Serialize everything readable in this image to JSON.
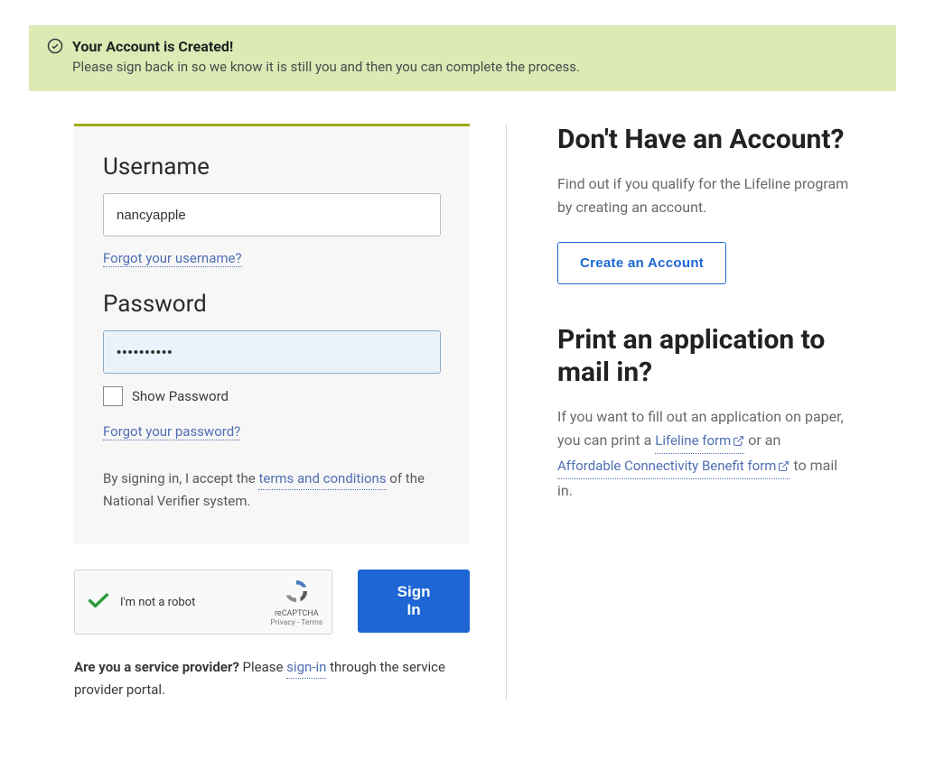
{
  "alert": {
    "title": "Your Account is Created!",
    "text": "Please sign back in so we know it is still you and then you can complete the process."
  },
  "login": {
    "username_label": "Username",
    "username_value": "nancyapple",
    "forgot_username": "Forgot your username?",
    "password_label": "Password",
    "password_value": "••••••••••",
    "show_password": "Show Password",
    "forgot_password": "Forgot your password?",
    "terms_prefix": "By signing in, I accept the ",
    "terms_link": "terms and conditions",
    "terms_suffix": " of the National Verifier system."
  },
  "recaptcha": {
    "label": "I'm not a robot",
    "brand": "reCAPTCHA",
    "privacy": "Privacy",
    "terms": "Terms"
  },
  "signin_button": "Sign In",
  "provider": {
    "question": "Are you a service provider?",
    "prefix": " Please ",
    "link": "sign-in",
    "suffix": " through the service provider portal."
  },
  "right": {
    "heading1": "Don't Have an Account?",
    "para1": "Find out if you qualify for the Lifeline program by creating an account.",
    "create_btn": "Create an Account",
    "heading2": "Print an application to mail in?",
    "para2_prefix": "If you want to fill out an application on paper, you can print a ",
    "lifeline_link": "Lifeline form",
    "para2_mid": " or an ",
    "acp_link": "Affordable Connectivity Benefit form",
    "para2_suffix": " to mail in."
  }
}
